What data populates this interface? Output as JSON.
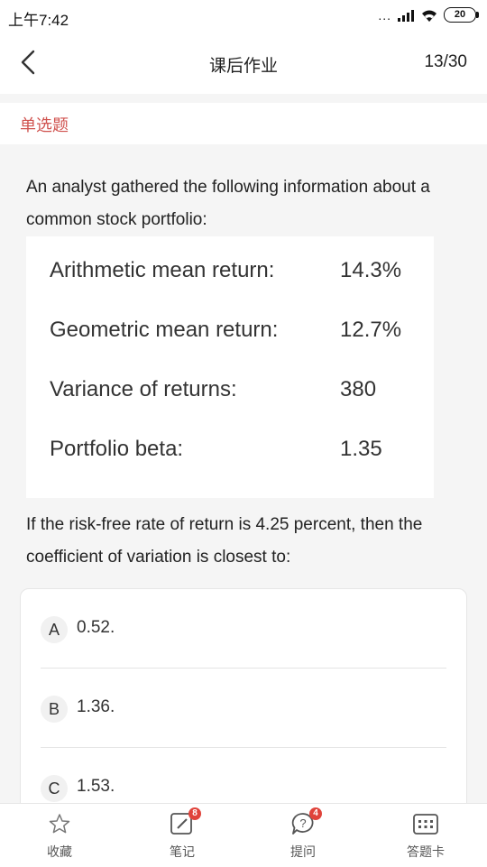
{
  "status_bar": {
    "time": "上午7:42",
    "signal_dots": "...",
    "battery": "20"
  },
  "nav": {
    "title": "课后作业",
    "counter": "13/30"
  },
  "question_type": "单选题",
  "question": {
    "stem": "An analyst gathered the following information about a common stock portfolio:",
    "info": [
      {
        "label": "Arithmetic mean return:",
        "value": "14.3%"
      },
      {
        "label": "Geometric mean return:",
        "value": "12.7%"
      },
      {
        "label": "Variance of returns:",
        "value": "380"
      },
      {
        "label": "Portfolio beta:",
        "value": "1.35"
      }
    ],
    "stem2": "If the risk-free rate of return is 4.25 percent, then the coefficient of variation is closest to:"
  },
  "options": [
    {
      "letter": "A",
      "text": "0.52."
    },
    {
      "letter": "B",
      "text": "1.36."
    },
    {
      "letter": "C",
      "text": "1.53."
    }
  ],
  "tabbar": {
    "favorite": {
      "label": "收藏",
      "icon": "star-icon"
    },
    "notes": {
      "label": "笔记",
      "badge": "8",
      "icon": "edit-note-icon"
    },
    "ask": {
      "label": "提问",
      "badge": "4",
      "icon": "question-bubble-icon"
    },
    "answer_card": {
      "label": "答题卡",
      "icon": "grid-card-icon"
    }
  },
  "colors": {
    "accent_red": "#d0534f",
    "badge_red": "#e0433b"
  }
}
